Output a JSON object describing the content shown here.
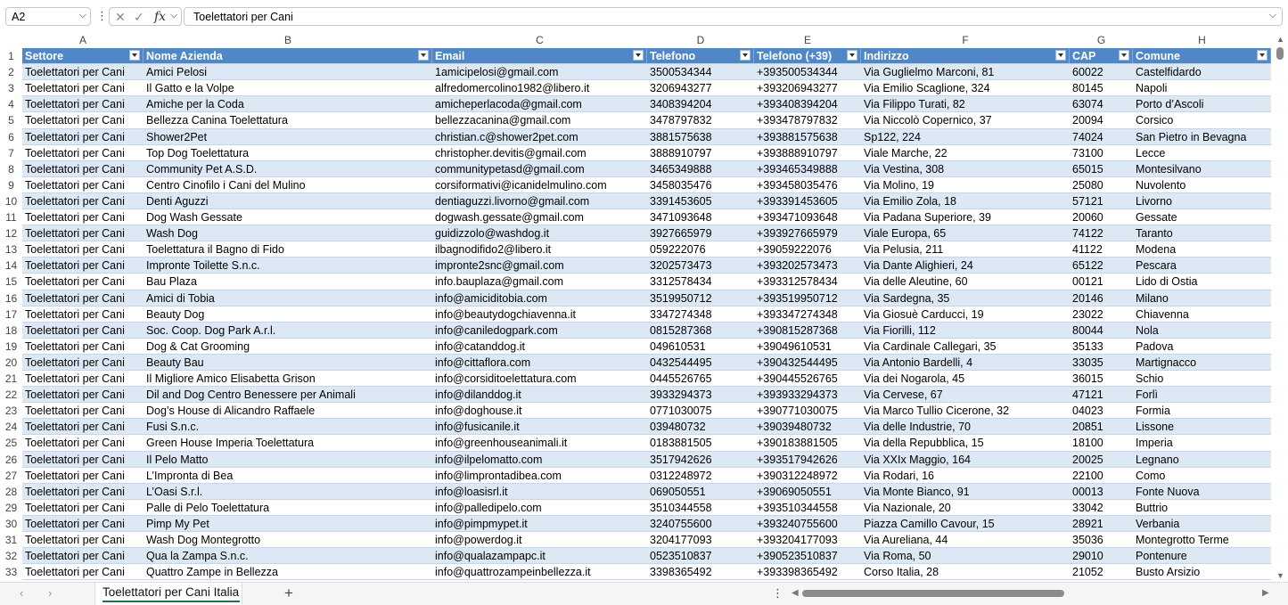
{
  "formula_bar": {
    "name_box": "A2",
    "fx_label": "fx",
    "cancel_glyph": "✕",
    "enter_glyph": "✓",
    "content": "Toelettatori per Cani"
  },
  "columns": [
    "A",
    "B",
    "C",
    "D",
    "E",
    "F",
    "G",
    "H"
  ],
  "header": [
    "Settore",
    "Nome Azienda",
    "Email",
    "Telefono",
    "Telefono (+39)",
    "Indirizzo",
    "CAP",
    "Comune"
  ],
  "rows": [
    [
      "Toelettatori per Cani",
      "Amici Pelosi",
      "1amicipelosi@gmail.com",
      "3500534344",
      "+393500534344",
      "Via Guglielmo Marconi, 81",
      "60022",
      "Castelfidardo"
    ],
    [
      "Toelettatori per Cani",
      "Il Gatto e la Volpe",
      "alfredomercolino1982@libero.it",
      "3206943277",
      "+393206943277",
      "Via Emilio Scaglione, 324",
      "80145",
      "Napoli"
    ],
    [
      "Toelettatori per Cani",
      "Amiche per la Coda",
      "amicheperlacoda@gmail.com",
      "3408394204",
      "+393408394204",
      "Via Filippo Turati, 82",
      "63074",
      "Porto d’Ascoli"
    ],
    [
      "Toelettatori per Cani",
      "Bellezza Canina Toelettatura",
      "bellezzacanina@gmail.com",
      "3478797832",
      "+393478797832",
      "Via Niccolò Copernico, 37",
      "20094",
      "Corsico"
    ],
    [
      "Toelettatori per Cani",
      "Shower2Pet",
      "christian.c@shower2pet.com",
      "3881575638",
      "+393881575638",
      "Sp122, 224",
      "74024",
      "San Pietro in Bevagna"
    ],
    [
      "Toelettatori per Cani",
      "Top Dog Toelettatura",
      "christopher.devitis@gmail.com",
      "3888910797",
      "+393888910797",
      "Viale Marche, 22",
      "73100",
      "Lecce"
    ],
    [
      "Toelettatori per Cani",
      "Community Pet A.S.D.",
      "communitypetasd@gmail.com",
      "3465349888",
      "+393465349888",
      "Via Vestina, 308",
      "65015",
      "Montesilvano"
    ],
    [
      "Toelettatori per Cani",
      "Centro Cinofilo i Cani del Mulino",
      "corsiformativi@icanidelmulino.com",
      "3458035476",
      "+393458035476",
      "Via Molino, 19",
      "25080",
      "Nuvolento"
    ],
    [
      "Toelettatori per Cani",
      "Denti Aguzzi",
      "dentiaguzzi.livorno@gmail.com",
      "3391453605",
      "+393391453605",
      "Via Emilio Zola, 18",
      "57121",
      "Livorno"
    ],
    [
      "Toelettatori per Cani",
      "Dog Wash Gessate",
      "dogwash.gessate@gmail.com",
      "3471093648",
      "+393471093648",
      "Via Padana Superiore, 39",
      "20060",
      "Gessate"
    ],
    [
      "Toelettatori per Cani",
      "Wash Dog",
      "guidizzolo@washdog.it",
      "3927665979",
      "+393927665979",
      "Viale Europa, 65",
      "74122",
      "Taranto"
    ],
    [
      "Toelettatori per Cani",
      "Toelettatura il Bagno di Fido",
      "ilbagnodifido2@libero.it",
      "059222076",
      "+39059222076",
      "Via Pelusia, 211",
      "41122",
      "Modena"
    ],
    [
      "Toelettatori per Cani",
      "Impronte Toilette S.n.c.",
      "impronte2snc@gmail.com",
      "3202573473",
      "+393202573473",
      "Via Dante Alighieri, 24",
      "65122",
      "Pescara"
    ],
    [
      "Toelettatori per Cani",
      "Bau Plaza",
      "info.bauplaza@gmail.com",
      "3312578434",
      "+393312578434",
      "Via delle Aleutine, 60",
      "00121",
      "Lido di Ostia"
    ],
    [
      "Toelettatori per Cani",
      "Amici di Tobia",
      "info@amiciditobia.com",
      "3519950712",
      "+393519950712",
      "Via Sardegna, 35",
      "20146",
      "Milano"
    ],
    [
      "Toelettatori per Cani",
      "Beauty Dog",
      "info@beautydogchiavenna.it",
      "3347274348",
      "+393347274348",
      "Via Giosuè Carducci, 19",
      "23022",
      "Chiavenna"
    ],
    [
      "Toelettatori per Cani",
      "Soc. Coop. Dog Park A.r.l.",
      "info@caniledogpark.com",
      "0815287368",
      "+390815287368",
      "Via Fiorilli, 112",
      "80044",
      "Nola"
    ],
    [
      "Toelettatori per Cani",
      "Dog & Cat Grooming",
      "info@catanddog.it",
      "049610531",
      "+39049610531",
      "Via Cardinale Callegari, 35",
      "35133",
      "Padova"
    ],
    [
      "Toelettatori per Cani",
      "Beauty Bau",
      "info@cittaflora.com",
      "0432544495",
      "+390432544495",
      "Via Antonio Bardelli, 4",
      "33035",
      "Martignacco"
    ],
    [
      "Toelettatori per Cani",
      "Il Migliore Amico Elisabetta Grison",
      "info@corsiditoelettatura.com",
      "0445526765",
      "+390445526765",
      "Via dei Nogarola, 45",
      "36015",
      "Schio"
    ],
    [
      "Toelettatori per Cani",
      "Dil and Dog Centro Benessere per Animali",
      "info@dilanddog.it",
      "3933294373",
      "+393933294373",
      "Via Cervese, 67",
      "47121",
      "Forlì"
    ],
    [
      "Toelettatori per Cani",
      "Dog’s House di Alicandro Raffaele",
      "info@doghouse.it",
      "0771030075",
      "+390771030075",
      "Via Marco Tullio Cicerone, 32",
      "04023",
      "Formia"
    ],
    [
      "Toelettatori per Cani",
      "Fusi S.n.c.",
      "info@fusicanile.it",
      "039480732",
      "+39039480732",
      "Via delle Industrie, 70",
      "20851",
      "Lissone"
    ],
    [
      "Toelettatori per Cani",
      "Green House Imperia Toelettatura",
      "info@greenhouseanimali.it",
      "0183881505",
      "+390183881505",
      "Via della Repubblica, 15",
      "18100",
      "Imperia"
    ],
    [
      "Toelettatori per Cani",
      "Il Pelo Matto",
      "info@ilpelomatto.com",
      "3517942626",
      "+393517942626",
      "Via XXIx Maggio, 164",
      "20025",
      "Legnano"
    ],
    [
      "Toelettatori per Cani",
      "L’Impronta di Bea",
      "info@limprontadibea.com",
      "0312248972",
      "+390312248972",
      "Via Rodari, 16",
      "22100",
      "Como"
    ],
    [
      "Toelettatori per Cani",
      "L’Oasi S.r.l.",
      "info@loasisrl.it",
      "069050551",
      "+39069050551",
      "Via Monte Bianco, 91",
      "00013",
      "Fonte Nuova"
    ],
    [
      "Toelettatori per Cani",
      "Palle di Pelo Toelettatura",
      "info@palledipelo.com",
      "3510344558",
      "+393510344558",
      "Via Nazionale, 20",
      "33042",
      "Buttrio"
    ],
    [
      "Toelettatori per Cani",
      "Pimp My Pet",
      "info@pimpmypet.it",
      "3240755600",
      "+393240755600",
      "Piazza Camillo Cavour, 15",
      "28921",
      "Verbania"
    ],
    [
      "Toelettatori per Cani",
      "Wash Dog Montegrotto",
      "info@powerdog.it",
      "3204177093",
      "+393204177093",
      "Via Aureliana, 44",
      "35036",
      "Montegrotto Terme"
    ],
    [
      "Toelettatori per Cani",
      "Qua la Zampa S.n.c.",
      "info@qualazampapc.it",
      "0523510837",
      "+390523510837",
      "Via Roma, 50",
      "29010",
      "Pontenure"
    ],
    [
      "Toelettatori per Cani",
      "Quattro Zampe in Bellezza",
      "info@quattrozampeinbellezza.it",
      "3398365492",
      "+393398365492",
      "Corso Italia, 28",
      "21052",
      "Busto Arsizio"
    ]
  ],
  "sheet_tab": "Toelettatori per Cani Italia",
  "add_sheet_glyph": "+",
  "colors": {
    "header_bg": "#4f87c7",
    "band_bg": "#dde8f5",
    "tab_accent": "#1e7145"
  }
}
